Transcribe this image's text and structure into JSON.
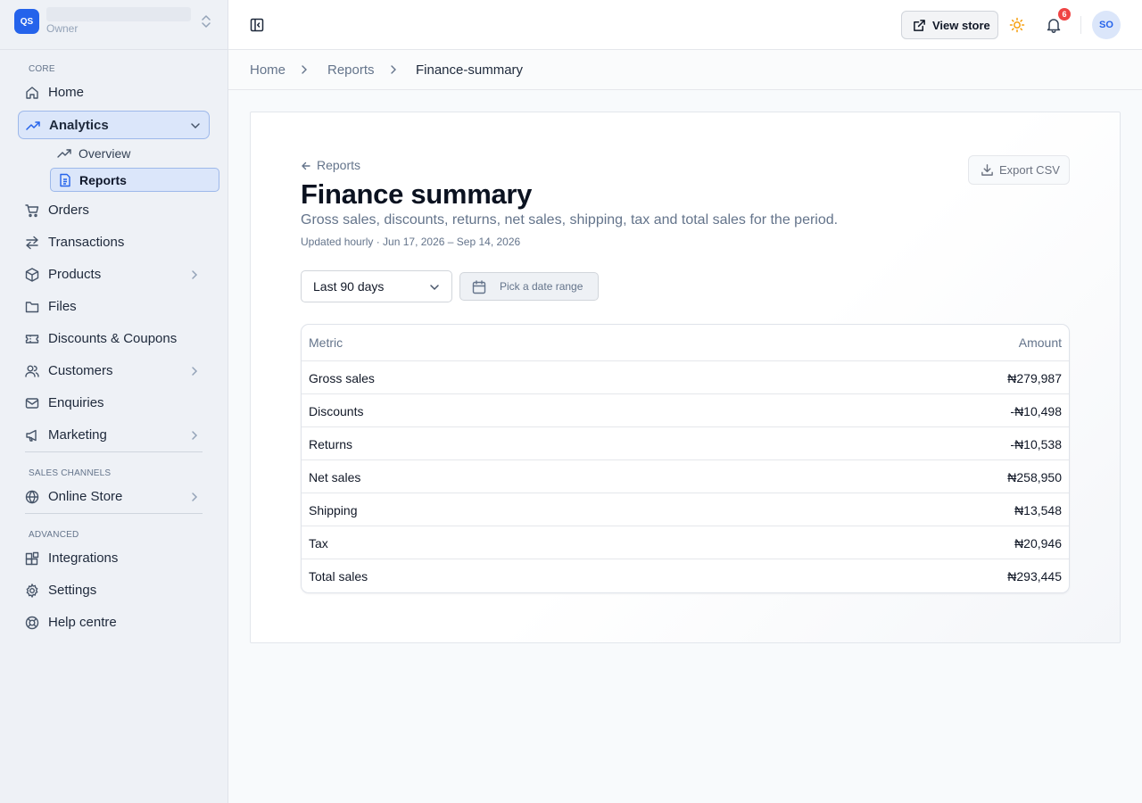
{
  "store": {
    "logo_text": "QS",
    "role": "Owner"
  },
  "sidebar": {
    "sections": {
      "core": "CORE",
      "sales_channels": "SALES CHANNELS",
      "advanced": "ADVANCED"
    },
    "items": {
      "home": "Home",
      "analytics": "Analytics",
      "overview": "Overview",
      "reports": "Reports",
      "orders": "Orders",
      "transactions": "Transactions",
      "products": "Products",
      "files": "Files",
      "discounts": "Discounts & Coupons",
      "customers": "Customers",
      "enquiries": "Enquiries",
      "marketing": "Marketing",
      "online_store": "Online Store",
      "integrations": "Integrations",
      "settings": "Settings",
      "help": "Help centre"
    }
  },
  "topbar": {
    "view_store": "View store",
    "notifications_count": "6",
    "avatar_initials": "SO"
  },
  "breadcrumb": [
    "Home",
    "Reports",
    "Finance-summary"
  ],
  "page": {
    "back_label": "Reports",
    "export_label": "Export CSV",
    "title": "Finance summary",
    "subtitle": "Gross sales, discounts, returns, net sales, shipping, tax and total sales for the period.",
    "updated": "Updated hourly · Jun 17, 2026 – Sep 14, 2026",
    "range_selected": "Last 90 days",
    "date_range_placeholder": "Pick a date range"
  },
  "table": {
    "headers": {
      "metric": "Metric",
      "amount": "Amount"
    },
    "rows": [
      {
        "metric": "Gross sales",
        "amount": "₦279,987"
      },
      {
        "metric": "Discounts",
        "amount": "-₦10,498"
      },
      {
        "metric": "Returns",
        "amount": "-₦10,538"
      },
      {
        "metric": "Net sales",
        "amount": "₦258,950"
      },
      {
        "metric": "Shipping",
        "amount": "₦13,548"
      },
      {
        "metric": "Tax",
        "amount": "₦20,946"
      },
      {
        "metric": "Total sales",
        "amount": "₦293,445"
      }
    ]
  },
  "colors": {
    "accent": "#2563eb",
    "badge": "#ef4444",
    "theme_icon": "#f59e0b"
  }
}
